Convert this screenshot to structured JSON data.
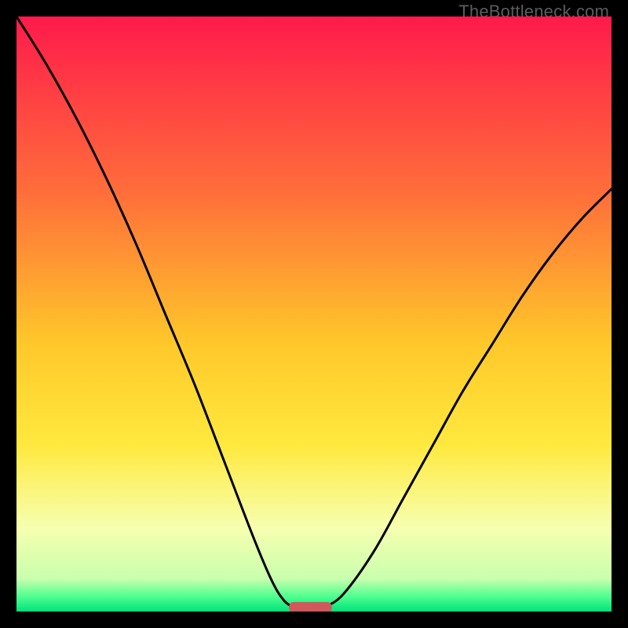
{
  "watermark": "TheBottleneck.com",
  "chart_data": {
    "type": "line",
    "title": "",
    "xlabel": "",
    "ylabel": "",
    "xlim": [
      0,
      100
    ],
    "ylim": [
      0,
      100
    ],
    "grid": false,
    "background_gradient_stops": [
      {
        "offset": 0.0,
        "color": "#ff1a4b"
      },
      {
        "offset": 0.3,
        "color": "#ff6f3a"
      },
      {
        "offset": 0.55,
        "color": "#ffc82a"
      },
      {
        "offset": 0.72,
        "color": "#ffe93e"
      },
      {
        "offset": 0.86,
        "color": "#f7ffb0"
      },
      {
        "offset": 0.945,
        "color": "#c9ffad"
      },
      {
        "offset": 0.975,
        "color": "#4eff8f"
      },
      {
        "offset": 1.0,
        "color": "#00e27a"
      }
    ],
    "series": [
      {
        "name": "left-curve",
        "x": [
          0,
          5,
          10,
          15,
          20,
          25,
          30,
          35,
          40,
          43,
          45,
          46.5
        ],
        "y": [
          100,
          92,
          83,
          73,
          62,
          50,
          38,
          25,
          12,
          5,
          1.8,
          0.8
        ]
      },
      {
        "name": "right-curve",
        "x": [
          52,
          55,
          60,
          65,
          70,
          75,
          80,
          85,
          90,
          95,
          100,
          100
        ],
        "y": [
          0.8,
          3,
          10,
          19,
          28,
          37,
          45,
          53,
          60,
          66,
          71,
          71
        ]
      }
    ],
    "markers": [
      {
        "name": "optimum-marker",
        "type": "rounded-rect",
        "x_center": 49.4,
        "y": 0.7,
        "width": 7.2,
        "height": 1.8,
        "fill": "#d1585a"
      }
    ]
  }
}
